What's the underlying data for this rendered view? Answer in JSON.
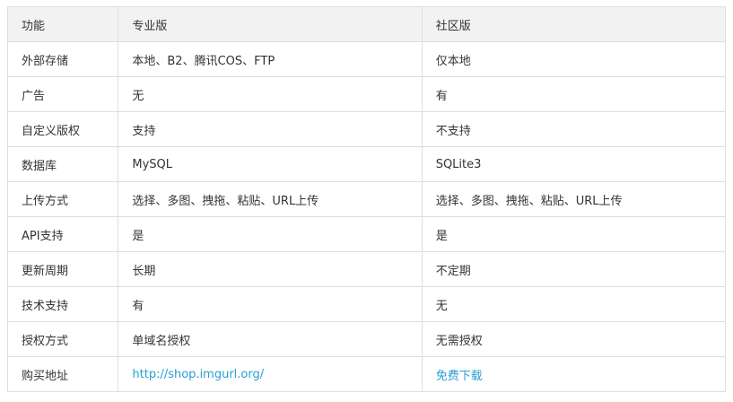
{
  "table": {
    "headers": [
      "功能",
      "专业版",
      "社区版"
    ],
    "rows": [
      [
        "外部存储",
        "本地、B2、腾讯COS、FTP",
        "仅本地"
      ],
      [
        "广告",
        "无",
        "有"
      ],
      [
        "自定义版权",
        "支持",
        "不支持"
      ],
      [
        "数据库",
        "MySQL",
        "SQLite3"
      ],
      [
        "上传方式",
        "选择、多图、拽拖、粘贴、URL上传",
        "选择、多图、拽拖、粘贴、URL上传"
      ],
      [
        "API支持",
        "是",
        "是"
      ],
      [
        "更新周期",
        "长期",
        "不定期"
      ],
      [
        "技术支持",
        "有",
        "无"
      ],
      [
        "授权方式",
        "单域名授权",
        "无需授权"
      ],
      [
        "购买地址",
        "http://shop.imgurl.org/",
        "免费下载"
      ]
    ]
  },
  "colors": {
    "header_bg": "#f2f2f2",
    "border": "#dddddd",
    "text": "#333333",
    "link": "#2a9fd6"
  }
}
